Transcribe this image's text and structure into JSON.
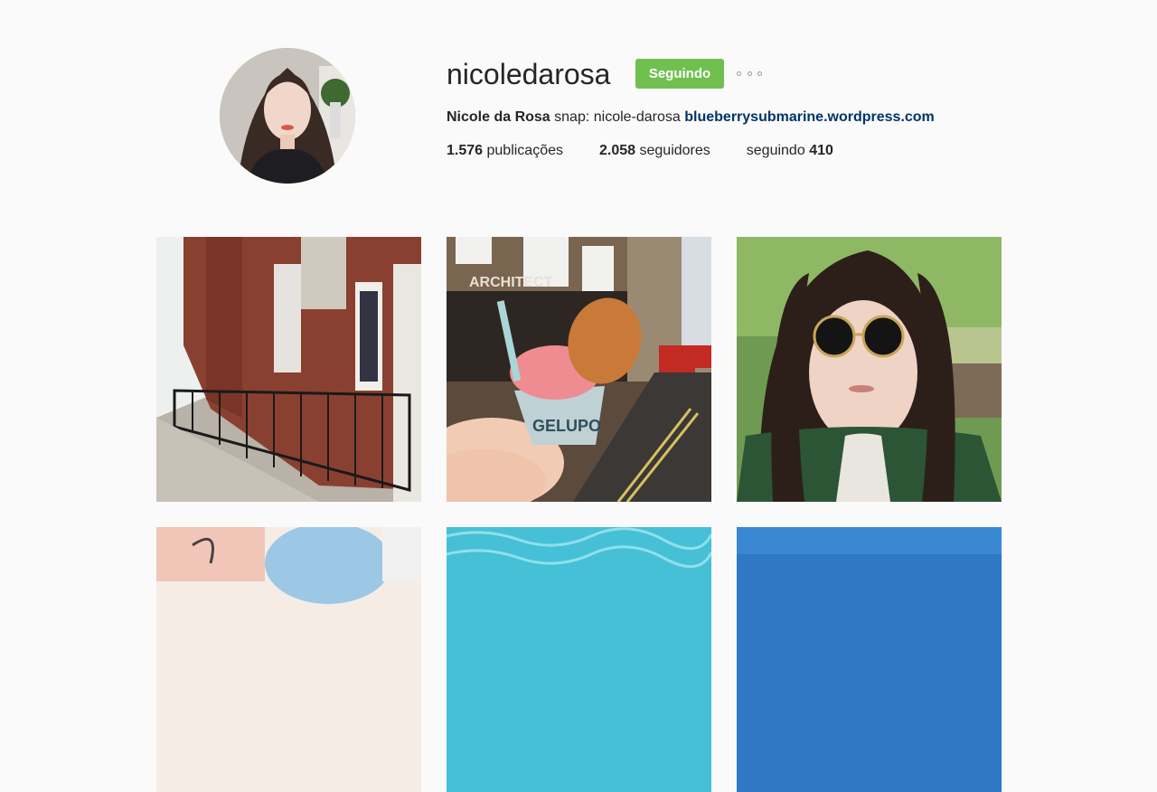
{
  "profile": {
    "username": "nicoledarosa",
    "follow_label": "Seguindo",
    "more_icon": "more-horizontal-icon",
    "full_name": "Nicole da Rosa",
    "bio": "snap: nicole-darosa",
    "website": "blueberrysubmarine.wordpress.com",
    "posts_count": "1.576",
    "posts_label": "publicações",
    "followers_count": "2.058",
    "followers_label": "seguidores",
    "following_label": "seguindo",
    "following_count": "410"
  },
  "posts": [
    {
      "id": "post-1",
      "sign_text": ""
    },
    {
      "id": "post-2",
      "sign_text": "ARCHITECT",
      "cup_text": "GELUPO"
    },
    {
      "id": "post-3"
    },
    {
      "id": "post-4"
    },
    {
      "id": "post-5"
    },
    {
      "id": "post-6"
    }
  ],
  "colors": {
    "follow_button": "#70c050",
    "link": "#003569",
    "background": "#fafafa"
  }
}
